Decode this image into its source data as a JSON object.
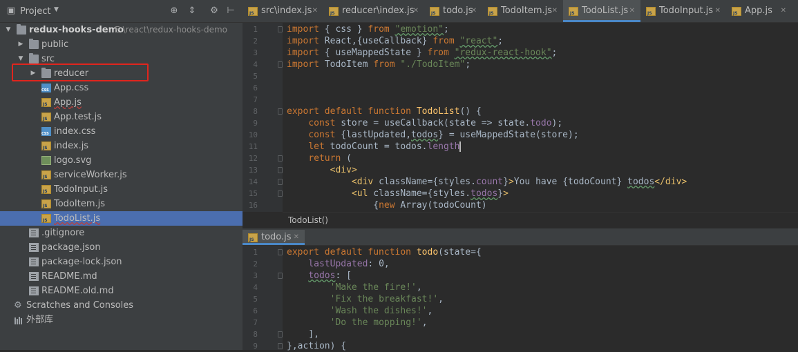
{
  "project_panel": {
    "title": "Project",
    "tree": [
      {
        "label": "redux-hooks-demo",
        "hint": "E:\\react\\redux-hooks-demo",
        "type": "folder",
        "depth": 0,
        "expanded": true
      },
      {
        "label": "public",
        "type": "folder",
        "depth": 1,
        "expanded": false
      },
      {
        "label": "src",
        "type": "folder",
        "depth": 1,
        "expanded": true
      },
      {
        "label": "reducer",
        "type": "folder",
        "depth": 2,
        "expanded": false
      },
      {
        "label": "App.css",
        "type": "css",
        "depth": 2
      },
      {
        "label": "App.js",
        "type": "js",
        "depth": 2
      },
      {
        "label": "App.test.js",
        "type": "js",
        "depth": 2
      },
      {
        "label": "index.css",
        "type": "css",
        "depth": 2
      },
      {
        "label": "index.js",
        "type": "js",
        "depth": 2
      },
      {
        "label": "logo.svg",
        "type": "svg",
        "depth": 2
      },
      {
        "label": "serviceWorker.js",
        "type": "js",
        "depth": 2
      },
      {
        "label": "TodoInput.js",
        "type": "js",
        "depth": 2
      },
      {
        "label": "TodoItem.js",
        "type": "js",
        "depth": 2
      },
      {
        "label": "TodoList.js",
        "type": "js",
        "depth": 2,
        "selected": true
      },
      {
        "label": ".gitignore",
        "type": "txt",
        "depth": 1
      },
      {
        "label": "package.json",
        "type": "json",
        "depth": 1
      },
      {
        "label": "package-lock.json",
        "type": "json",
        "depth": 1
      },
      {
        "label": "README.md",
        "type": "txt",
        "depth": 1
      },
      {
        "label": "README.old.md",
        "type": "txt",
        "depth": 1
      },
      {
        "label": "Scratches and Consoles",
        "type": "scratch",
        "depth": 0
      },
      {
        "label": "外部库",
        "type": "library",
        "depth": 0
      }
    ]
  },
  "editor_tabs": [
    {
      "label": "src\\index.js",
      "active": false
    },
    {
      "label": "reducer\\index.js",
      "active": false
    },
    {
      "label": "todo.js",
      "active": false
    },
    {
      "label": "TodoItem.js",
      "active": false
    },
    {
      "label": "TodoList.js",
      "active": true
    },
    {
      "label": "TodoInput.js",
      "active": false
    },
    {
      "label": "App.js",
      "active": false
    }
  ],
  "top_editor": {
    "lines": [
      [
        [
          "kw",
          "import "
        ],
        [
          "",
          "{ css } "
        ],
        [
          "kw",
          "from "
        ],
        [
          "str wv",
          "\"emotion\""
        ],
        [
          "",
          ";"
        ]
      ],
      [
        [
          "kw",
          "import "
        ],
        [
          "",
          "React,{useCallback} "
        ],
        [
          "kw",
          "from "
        ],
        [
          "str wv",
          "\"react\""
        ],
        [
          "",
          ";"
        ]
      ],
      [
        [
          "kw",
          "import "
        ],
        [
          "",
          "{ useMappedState } "
        ],
        [
          "kw",
          "from "
        ],
        [
          "str wv",
          "\"redux-react-hook\""
        ],
        [
          "",
          ";"
        ]
      ],
      [
        [
          "kw",
          "import "
        ],
        [
          "",
          "TodoItem "
        ],
        [
          "kw",
          "from "
        ],
        [
          "str",
          "\"./TodoItem\""
        ],
        [
          "",
          ";"
        ]
      ],
      [],
      [],
      [],
      [
        [
          "kw",
          "export default function "
        ],
        [
          "fn",
          "TodoList"
        ],
        [
          "",
          "() {"
        ]
      ],
      [
        [
          "",
          "    "
        ],
        [
          "kw",
          "const "
        ],
        [
          "",
          "store = useCallback(state => state."
        ],
        [
          "prop",
          "todo"
        ],
        [
          "",
          ");"
        ]
      ],
      [
        [
          "",
          "    "
        ],
        [
          "kw",
          "const "
        ],
        [
          "",
          "{lastUpdated,"
        ],
        [
          "wv",
          "todos"
        ],
        [
          "",
          "} = useMappedState(store);"
        ]
      ],
      [
        [
          "",
          "    "
        ],
        [
          "kw",
          "let "
        ],
        [
          "",
          "todoCount = todos."
        ],
        [
          "prop",
          "length"
        ],
        [
          "cur",
          ""
        ]
      ],
      [
        [
          "",
          "    "
        ],
        [
          "kw",
          "return "
        ],
        [
          "",
          "("
        ]
      ],
      [
        [
          "",
          "        "
        ],
        [
          "tag",
          "<div"
        ],
        [
          "tag",
          ">"
        ]
      ],
      [
        [
          "",
          "            "
        ],
        [
          "tag",
          "<div "
        ],
        [
          "",
          "className="
        ],
        [
          "",
          "{styles."
        ],
        [
          "prop",
          "count"
        ],
        [
          "",
          "}"
        ],
        [
          "tag",
          ">"
        ],
        [
          "",
          "You have {todoCount} "
        ],
        [
          "wv",
          "todos"
        ],
        [
          "tag",
          "</div>"
        ]
      ],
      [
        [
          "",
          "            "
        ],
        [
          "tag",
          "<ul "
        ],
        [
          "",
          "className="
        ],
        [
          "",
          "{styles."
        ],
        [
          "prop wv",
          "todos"
        ],
        [
          "",
          "}"
        ],
        [
          "tag",
          ">"
        ]
      ],
      [
        [
          "",
          "                {"
        ],
        [
          "kw",
          "new "
        ],
        [
          "",
          "Array(todoCount)"
        ]
      ]
    ]
  },
  "breadcrumb": "TodoList()",
  "bottom_tab": {
    "label": "todo.js"
  },
  "bottom_editor": {
    "lines": [
      [
        [
          "kw",
          "export default function "
        ],
        [
          "fn",
          "todo"
        ],
        [
          "",
          "(state={"
        ]
      ],
      [
        [
          "",
          "    "
        ],
        [
          "prop",
          "lastUpdated"
        ],
        [
          "",
          ": "
        ],
        [
          "",
          "0"
        ],
        [
          "",
          ","
        ]
      ],
      [
        [
          "",
          "    "
        ],
        [
          "prop wv",
          "todos"
        ],
        [
          "",
          ": ["
        ]
      ],
      [
        [
          "",
          "        "
        ],
        [
          "str",
          "'Make the fire!'"
        ],
        [
          "",
          ","
        ]
      ],
      [
        [
          "",
          "        "
        ],
        [
          "str",
          "'Fix the breakfast!'"
        ],
        [
          "",
          ","
        ]
      ],
      [
        [
          "",
          "        "
        ],
        [
          "str",
          "'Wash the dishes!'"
        ],
        [
          "",
          ","
        ]
      ],
      [
        [
          "",
          "        "
        ],
        [
          "str",
          "'Do the mopping!'"
        ],
        [
          "",
          ","
        ]
      ],
      [
        [
          "",
          "    ],"
        ]
      ],
      [
        [
          "",
          "},action) {"
        ]
      ]
    ]
  },
  "colors": {
    "selection": "#4b6eaf",
    "highlight_box": "#e0251d",
    "active_tab_underline": "#4a88c7"
  }
}
